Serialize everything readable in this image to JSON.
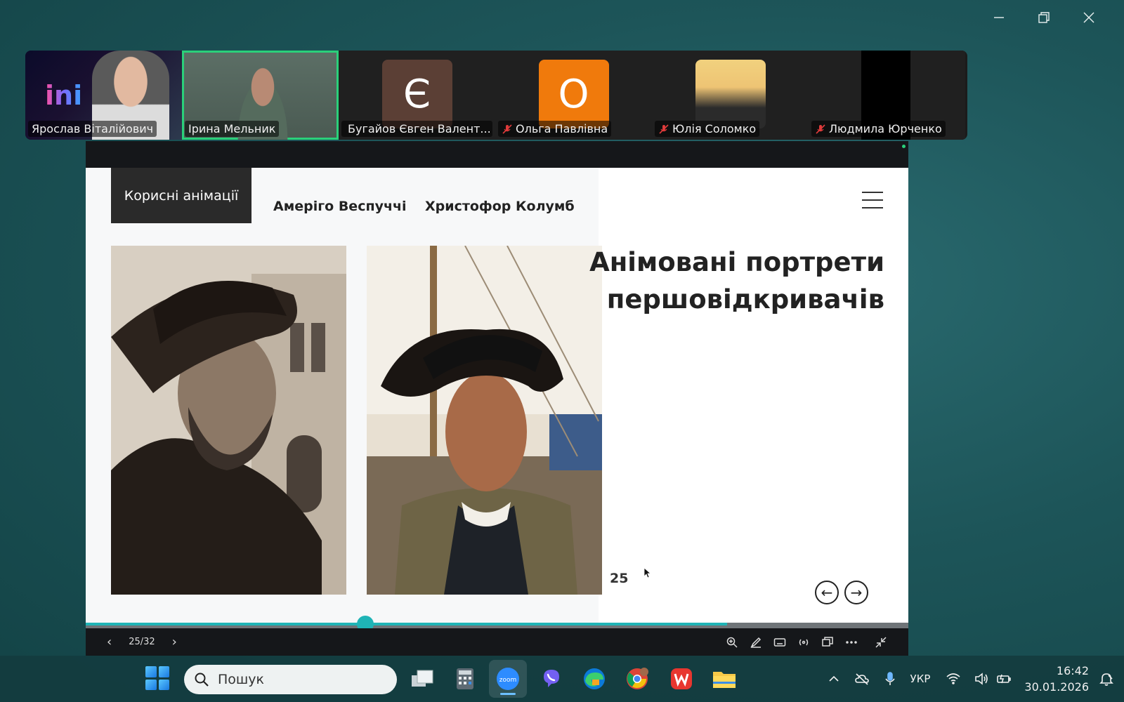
{
  "window": {
    "controls": [
      "minimize",
      "restore",
      "close"
    ]
  },
  "participants": [
    {
      "name": "Ярослав Віталійович",
      "muted": false,
      "kind": "video"
    },
    {
      "name": "Ірина Мельник",
      "muted": false,
      "kind": "video",
      "active": true
    },
    {
      "name": "Бугайов Євген Валент...",
      "muted": true,
      "kind": "initial",
      "initial": "Є",
      "color": "#5b3f35"
    },
    {
      "name": "Ольга Павлівна",
      "muted": true,
      "kind": "initial",
      "initial": "О",
      "color": "#f07a0c"
    },
    {
      "name": "Юлія Соломко",
      "muted": true,
      "kind": "photo"
    },
    {
      "name": "Людмила Юрченко",
      "muted": true,
      "kind": "video-off"
    }
  ],
  "video_overlay_text": "ini",
  "slide": {
    "nav_active": "Корисні анімації",
    "nav_items": [
      "Амеріго Веспуччі",
      "Христофор Колумб"
    ],
    "title_line1": "Анімовані портрети",
    "title_line2": "першовідкривачів",
    "page_number": "25",
    "prev_arrow": "←",
    "next_arrow": "→"
  },
  "presentation": {
    "pager": "25/32",
    "prev": "‹",
    "next": "›",
    "progress": 0.78,
    "knob_position": 0.34,
    "tools": [
      "zoom-in-icon",
      "pen-icon",
      "keyboard-icon",
      "broadcast-icon",
      "windows-icon",
      "more-icon",
      "exit-fullscreen-icon"
    ]
  },
  "taskbar": {
    "search_placeholder": "Пошук",
    "apps": [
      "task-view",
      "calculator",
      "zoom",
      "viber",
      "edge",
      "chrome",
      "wps-office",
      "file-explorer"
    ],
    "language": "УКР",
    "time": "16:42",
    "date": "30.01.2026"
  },
  "colors": {
    "accent_teal": "#1fb4b6",
    "active_speaker": "#2ad07a",
    "zoom_blue": "#2d8cff"
  }
}
